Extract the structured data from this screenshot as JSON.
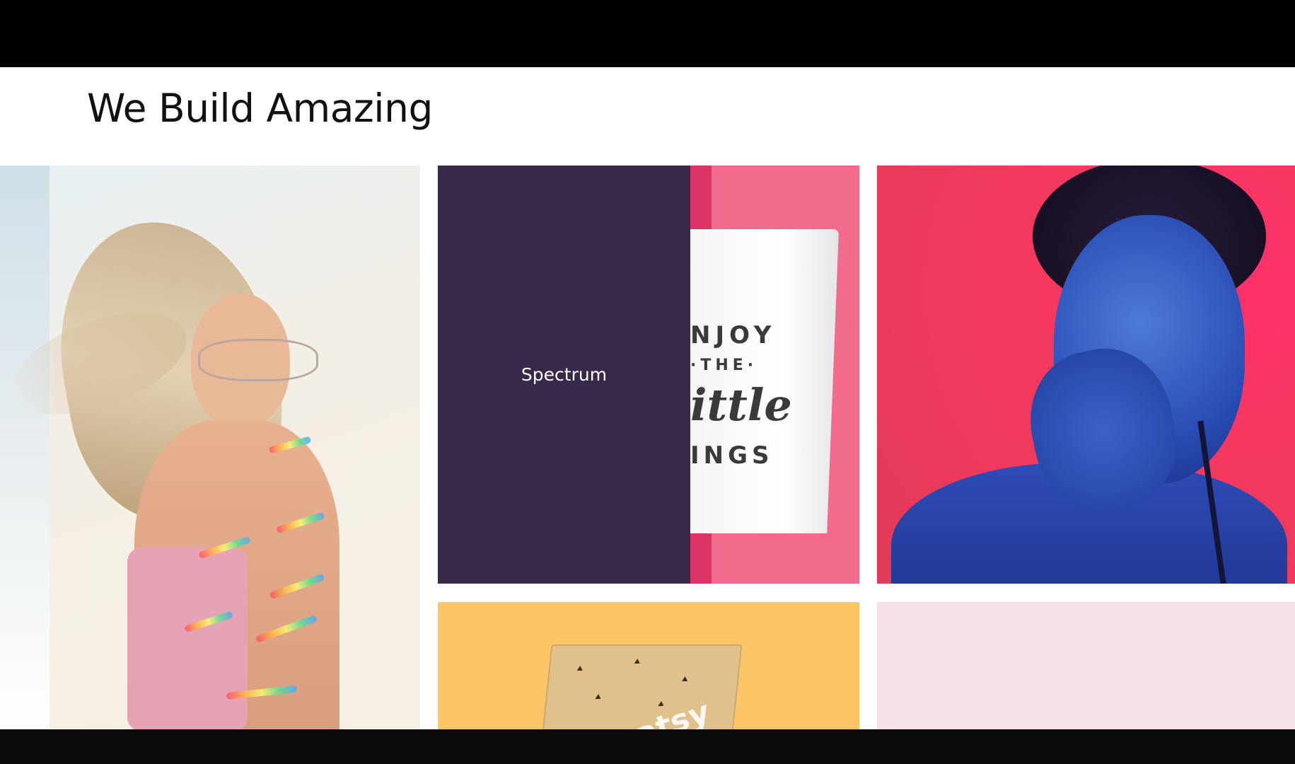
{
  "section": {
    "title": "We Build Amazing"
  },
  "portfolio": {
    "tiles": [
      {
        "name": "portrait-rainbow-light",
        "label": ""
      },
      {
        "name": "enjoy-the-little-things-cup",
        "label": "Spectrum",
        "cup_text": [
          "NJOY",
          "·THE·",
          "ittle",
          "INGS"
        ]
      },
      {
        "name": "blue-paint-singer",
        "label": ""
      },
      {
        "name": "treatsy-box",
        "label": "",
        "box_text": "reatsy"
      },
      {
        "name": "pink-tile",
        "label": ""
      }
    ]
  },
  "colors": {
    "overlay": "#38284a",
    "pink": "#f26b8c",
    "yellow": "#fcc566",
    "light_pink": "#f6e1ea"
  }
}
